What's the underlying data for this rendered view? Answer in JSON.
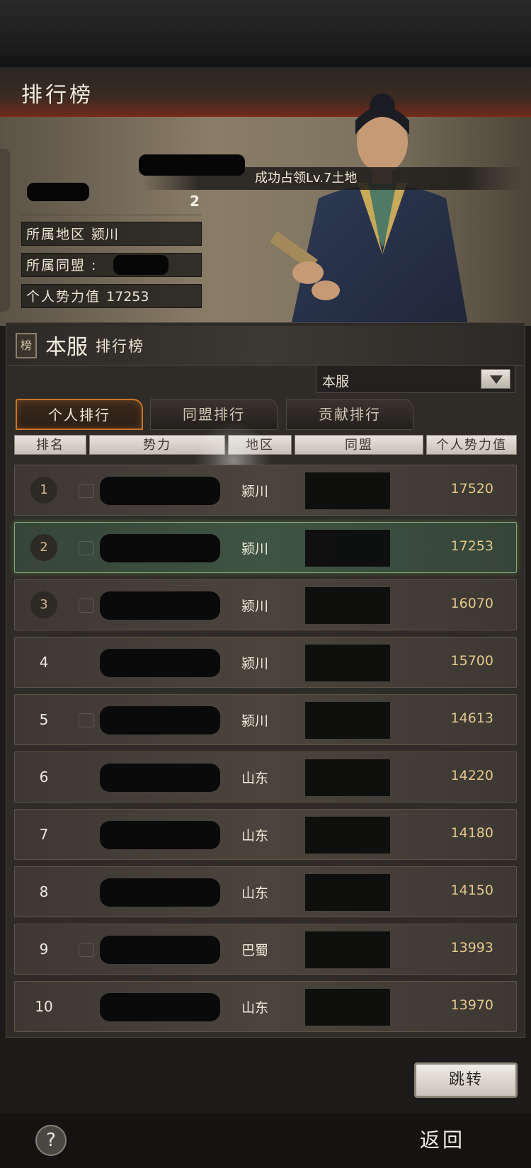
{
  "header": {
    "title": "排行榜"
  },
  "profile": {
    "headline": "成功占领Lv.7土地",
    "rank": "2",
    "region_label": "所属地区",
    "region_value": "颍川",
    "alliance_label": "所属同盟",
    "alliance_value": ":",
    "power_label": "个人势力值",
    "power_value": "17253"
  },
  "panel": {
    "badge": "榜",
    "title_big": "本服",
    "title_small": "排行榜",
    "dropdown_value": "本服"
  },
  "tabs": [
    {
      "label": "个人排行",
      "active": true
    },
    {
      "label": "同盟排行",
      "active": false
    },
    {
      "label": "贡献排行",
      "active": false
    }
  ],
  "columns": [
    "排名",
    "势力",
    "地区",
    "同盟",
    "个人势力值"
  ],
  "rows": [
    {
      "rank": "1",
      "region": "颍川",
      "value": "17520"
    },
    {
      "rank": "2",
      "region": "颍川",
      "value": "17253"
    },
    {
      "rank": "3",
      "region": "颍川",
      "value": "16070"
    },
    {
      "rank": "4",
      "region": "颍川",
      "value": "15700"
    },
    {
      "rank": "5",
      "region": "颍川",
      "value": "14613"
    },
    {
      "rank": "6",
      "region": "山东",
      "value": "14220"
    },
    {
      "rank": "7",
      "region": "山东",
      "value": "14180"
    },
    {
      "rank": "8",
      "region": "山东",
      "value": "14150"
    },
    {
      "rank": "9",
      "region": "巴蜀",
      "value": "13993"
    },
    {
      "rank": "10",
      "region": "山东",
      "value": "13970"
    }
  ],
  "buttons": {
    "jump": "跳转",
    "back": "返回",
    "help": "?"
  },
  "colors": {
    "accent": "#c8742a",
    "highlight": "#7fa776",
    "value": "#e2c88f"
  }
}
